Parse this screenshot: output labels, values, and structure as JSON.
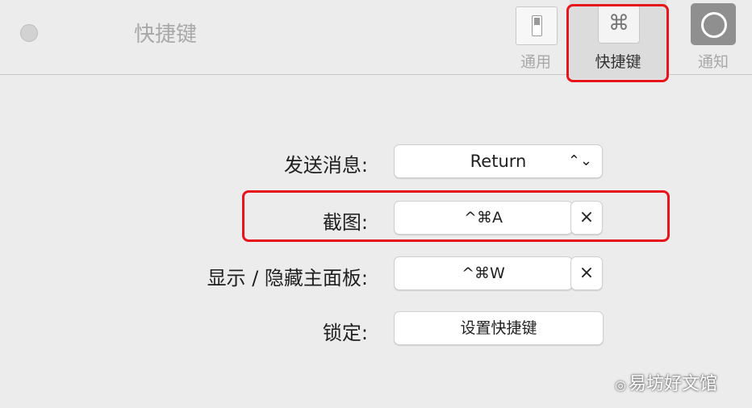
{
  "window": {
    "title": "快捷键"
  },
  "toolbar": {
    "tabs": [
      {
        "label": "通用",
        "icon": "toggle-switch-icon",
        "selected": false
      },
      {
        "label": "快捷键",
        "icon": "command-key-icon",
        "icon_glyph": "⌘",
        "selected": true
      },
      {
        "label": "通知",
        "icon": "notification-ring-icon",
        "selected": false
      }
    ]
  },
  "shortcuts": {
    "send": {
      "label": "发送消息:",
      "value": "Return",
      "chevron": "⌃⌄"
    },
    "screenshot": {
      "label": "截图:",
      "value": "^⌘A",
      "clear": "×"
    },
    "toggle_panel": {
      "label": "显示 / 隐藏主面板:",
      "value": "^⌘W",
      "clear": "×"
    },
    "lock": {
      "label": "锁定:",
      "button": "设置快捷键"
    }
  },
  "watermark": {
    "text": "易坊好文馆"
  },
  "colors": {
    "highlight": "#e8141c",
    "background": "#ececec"
  }
}
